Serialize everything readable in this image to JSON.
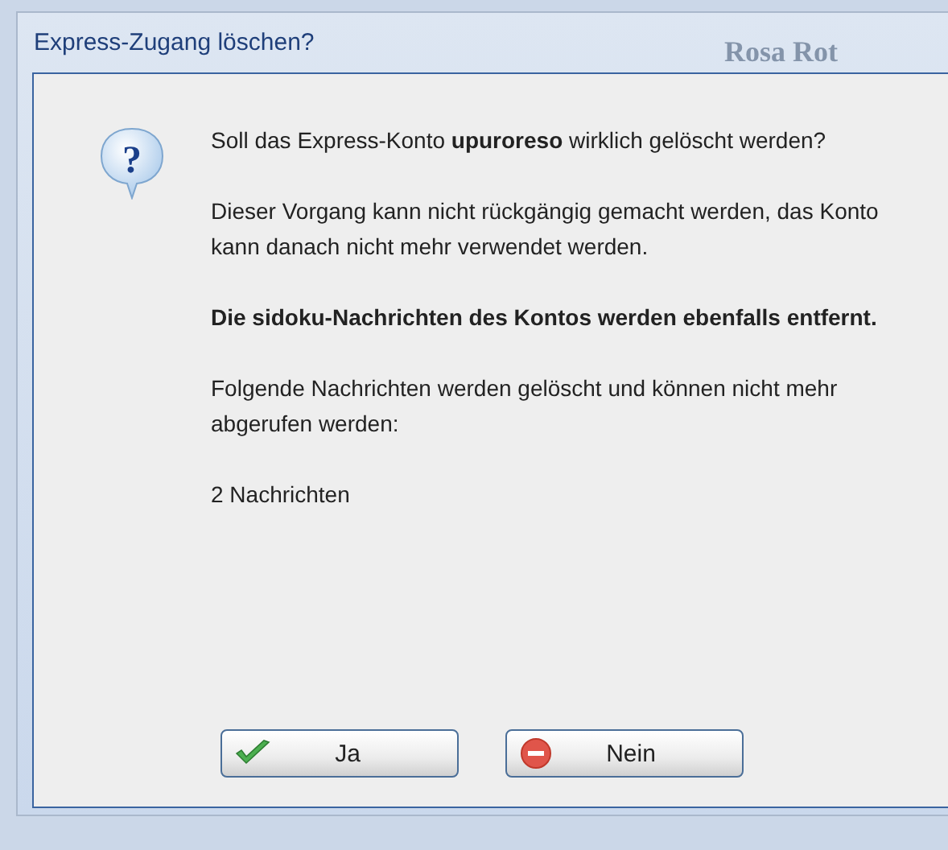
{
  "background_window": {
    "title": "Rosa Rot"
  },
  "dialog": {
    "title": "Express-Zugang löschen?",
    "icon_glyph": "?",
    "paragraphs": [
      {
        "text": "Soll das Express-Konto **upuroreso** wirklich gelöscht werden?",
        "bold": false
      },
      {
        "text": "Dieser Vorgang kann nicht rückgängig gemacht werden, das Konto kann danach nicht mehr verwendet werden.",
        "bold": false
      },
      {
        "text": "Die sidoku-Nachrichten des Kontos werden ebenfalls entfernt.",
        "bold": true
      },
      {
        "text": "Folgende Nachrichten werden gelöscht und können nicht mehr abgerufen werden:",
        "bold": false
      },
      {
        "text": "2 Nachrichten",
        "bold": false
      }
    ],
    "buttons": [
      {
        "label": "Ja",
        "kind": "confirm"
      },
      {
        "label": "Nein",
        "kind": "cancel"
      }
    ]
  }
}
